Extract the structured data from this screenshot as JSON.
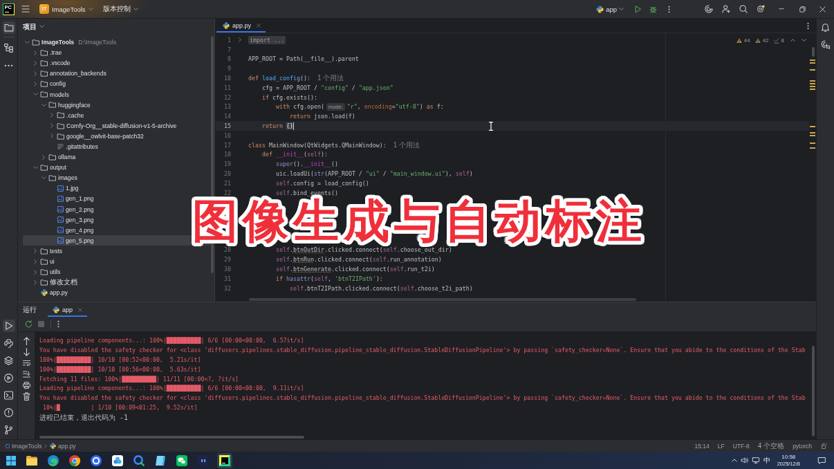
{
  "title_bar": {
    "logo": "PC",
    "project_badge": "IT",
    "project": "ImageTools",
    "vcs": "版本控制",
    "run_config": "app",
    "settings_update": true
  },
  "tool_windows": {
    "left_top": [
      {
        "kind": "project",
        "selected": true
      },
      {
        "kind": "structure",
        "selected": false
      },
      {
        "kind": "more",
        "selected": false
      }
    ],
    "left_bottom": [
      {
        "kind": "run",
        "selected": true
      },
      {
        "kind": "python_console",
        "selected": false
      },
      {
        "kind": "packages",
        "selected": false
      },
      {
        "kind": "services",
        "selected": false
      },
      {
        "kind": "terminal",
        "selected": false
      },
      {
        "kind": "problems",
        "selected": false
      },
      {
        "kind": "git",
        "selected": false
      }
    ],
    "right": [
      {
        "kind": "notifications",
        "selected": false
      },
      {
        "kind": "ai_chat",
        "selected": false
      }
    ]
  },
  "project_panel": {
    "title": "项目",
    "tree": [
      {
        "label": "ImageTools",
        "path": "D:\\ImageTools",
        "kind": "folder",
        "expanded": true,
        "selected": false,
        "children": [
          {
            "label": ".trae",
            "kind": "folder",
            "expanded": false,
            "selected": false
          },
          {
            "label": ".vscode",
            "kind": "folder",
            "expanded": false,
            "selected": false
          },
          {
            "label": "annotation_backends",
            "kind": "folder",
            "expanded": false,
            "selected": false
          },
          {
            "label": "config",
            "kind": "folder",
            "expanded": false,
            "selected": false
          },
          {
            "label": "models",
            "kind": "folder",
            "expanded": true,
            "selected": false,
            "children": [
              {
                "label": "huggingface",
                "kind": "folder",
                "expanded": true,
                "selected": false,
                "children": [
                  {
                    "label": ".cache",
                    "kind": "folder",
                    "expanded": false,
                    "selected": false
                  },
                  {
                    "label": "Comfy-Org__stable-diffusion-v1-5-archive",
                    "kind": "folder",
                    "expanded": false,
                    "selected": false
                  },
                  {
                    "label": "google__owlvit-base-patch32",
                    "kind": "folder",
                    "expanded": false,
                    "selected": false
                  },
                  {
                    "label": ".gitattributes",
                    "kind": "text",
                    "selected": false
                  }
                ]
              },
              {
                "label": "ollama",
                "kind": "folder",
                "expanded": false,
                "selected": false
              }
            ]
          },
          {
            "label": "output",
            "kind": "folder",
            "expanded": true,
            "selected": false,
            "children": [
              {
                "label": "images",
                "kind": "folder",
                "expanded": true,
                "selected": false,
                "children": [
                  {
                    "label": "1.jpg",
                    "kind": "image",
                    "selected": false
                  },
                  {
                    "label": "gen_1.png",
                    "kind": "image",
                    "selected": false
                  },
                  {
                    "label": "gen_2.png",
                    "kind": "image",
                    "selected": false
                  },
                  {
                    "label": "gen_3.png",
                    "kind": "image",
                    "selected": false
                  },
                  {
                    "label": "gen_4.png",
                    "kind": "image",
                    "selected": false
                  },
                  {
                    "label": "gen_5.png",
                    "kind": "image",
                    "selected": true
                  }
                ]
              }
            ]
          },
          {
            "label": "tests",
            "kind": "folder",
            "expanded": false,
            "selected": false
          },
          {
            "label": "ui",
            "kind": "folder",
            "expanded": false,
            "selected": false
          },
          {
            "label": "utils",
            "kind": "folder",
            "expanded": false,
            "selected": false
          },
          {
            "label": "修改文档",
            "kind": "folder",
            "expanded": false,
            "selected": false
          },
          {
            "label": "app.py",
            "kind": "python",
            "selected": false
          }
        ]
      }
    ]
  },
  "editor": {
    "tabs": [
      {
        "label": "app.py",
        "selected": true
      }
    ],
    "inspections": {
      "warnings": "44",
      "weak_warnings": "42",
      "typos": "8"
    },
    "lines": [
      {
        "kind": "code",
        "number": "1",
        "current": false,
        "tokens": [
          {
            "t": "import ...",
            "kind": "folded"
          }
        ]
      },
      {
        "kind": "code",
        "number": "7",
        "current": false
      },
      {
        "kind": "code",
        "number": "8",
        "current": false,
        "tokens": [
          {
            "t": "APP_ROOT = Path(__file__).parent",
            "kind": "plain"
          }
        ]
      },
      {
        "kind": "code",
        "number": "9",
        "current": false
      },
      {
        "kind": "code",
        "number": "10",
        "current": false,
        "tokens": [
          {
            "t": "def ",
            "kind": "keyword"
          },
          {
            "t": "load_config",
            "kind": "fn"
          },
          {
            "t": "():",
            "kind": "plain"
          },
          {
            "t": "1 个用法",
            "kind": "usage"
          }
        ]
      },
      {
        "kind": "code",
        "number": "11",
        "current": false,
        "tokens": [
          {
            "t": "    cfg = APP_ROOT / ",
            "kind": "plain"
          },
          {
            "t": "\"config\"",
            "kind": "string"
          },
          {
            "t": " / ",
            "kind": "plain"
          },
          {
            "t": "\"app.json\"",
            "kind": "string"
          }
        ]
      },
      {
        "kind": "code",
        "number": "12",
        "current": false,
        "tokens": [
          {
            "t": "    if ",
            "kind": "keyword"
          },
          {
            "t": "cfg.exists():",
            "kind": "plain"
          }
        ]
      },
      {
        "kind": "code",
        "number": "13",
        "current": false,
        "tokens": [
          {
            "t": "        with ",
            "kind": "keyword"
          },
          {
            "t": "cfg.open(",
            "kind": "plain"
          },
          {
            "t": "mode:",
            "kind": "hint"
          },
          {
            "t": "\"r\"",
            "kind": "string"
          },
          {
            "t": ", ",
            "kind": "plain"
          },
          {
            "t": "encoding",
            "kind": "param"
          },
          {
            "t": "=",
            "kind": "plain"
          },
          {
            "t": "\"utf-8\"",
            "kind": "string"
          },
          {
            "t": ") ",
            "kind": "plain"
          },
          {
            "t": "as ",
            "kind": "keyword"
          },
          {
            "t": "f:",
            "kind": "plain"
          }
        ]
      },
      {
        "kind": "code",
        "number": "14",
        "current": false,
        "tokens": [
          {
            "t": "            return ",
            "kind": "keyword"
          },
          {
            "t": "json.load(f)",
            "kind": "plain"
          }
        ]
      },
      {
        "kind": "code",
        "number": "15",
        "current": true,
        "tokens": [
          {
            "t": "    return ",
            "kind": "keyword"
          },
          {
            "t": "{}",
            "kind": "brace"
          }
        ]
      },
      {
        "kind": "code",
        "number": "16",
        "current": false
      },
      {
        "kind": "code",
        "number": "17",
        "current": false,
        "tokens": [
          {
            "t": "class ",
            "kind": "keyword"
          },
          {
            "t": "MainWindow(QtWidgets.QMainWindow):",
            "kind": "plain"
          },
          {
            "t": "1 个用法",
            "kind": "usage"
          }
        ]
      },
      {
        "kind": "code",
        "number": "18",
        "current": false,
        "tokens": [
          {
            "t": "    def ",
            "kind": "keyword"
          },
          {
            "t": "__init__",
            "kind": "dunder"
          },
          {
            "t": "(",
            "kind": "plain"
          },
          {
            "t": "self",
            "kind": "self"
          },
          {
            "t": "):",
            "kind": "plain"
          }
        ]
      },
      {
        "kind": "code",
        "number": "19",
        "current": false,
        "tokens": [
          {
            "t": "        super",
            "kind": "builtin"
          },
          {
            "t": "().",
            "kind": "plain"
          },
          {
            "t": "__init__",
            "kind": "dunder"
          },
          {
            "t": "()",
            "kind": "plain"
          }
        ]
      },
      {
        "kind": "code",
        "number": "20",
        "current": false,
        "tokens": [
          {
            "t": "        uic.loadUi(",
            "kind": "plain"
          },
          {
            "t": "str",
            "kind": "builtin"
          },
          {
            "t": "(APP_ROOT / ",
            "kind": "plain"
          },
          {
            "t": "\"ui\"",
            "kind": "string"
          },
          {
            "t": " / ",
            "kind": "plain"
          },
          {
            "t": "\"main_window.ui\"",
            "kind": "string"
          },
          {
            "t": "), ",
            "kind": "plain"
          },
          {
            "t": "self",
            "kind": "self"
          },
          {
            "t": ")",
            "kind": "plain"
          }
        ]
      },
      {
        "kind": "code",
        "number": "21",
        "current": false,
        "tokens": [
          {
            "t": "        self",
            "kind": "self"
          },
          {
            "t": ".config = load_config()",
            "kind": "plain"
          }
        ]
      },
      {
        "kind": "code",
        "number": "22",
        "current": false,
        "tokens": [
          {
            "t": "        self",
            "kind": "self"
          },
          {
            "t": ".bind_events()",
            "kind": "plain"
          }
        ]
      },
      {
        "kind": "covered"
      },
      {
        "kind": "covered"
      },
      {
        "kind": "covered"
      },
      {
        "kind": "covered"
      },
      {
        "kind": "covered"
      },
      {
        "kind": "code",
        "number": "28",
        "current": false,
        "tokens": [
          {
            "t": "        self",
            "kind": "self"
          },
          {
            "t": ".",
            "kind": "plain"
          },
          {
            "t": "btnOutDir",
            "kind": "warn"
          },
          {
            "t": ".clicked.connect(",
            "kind": "plain"
          },
          {
            "t": "self",
            "kind": "self"
          },
          {
            "t": ".choose_out_dir)",
            "kind": "plain"
          }
        ]
      },
      {
        "kind": "code",
        "number": "29",
        "current": false,
        "tokens": [
          {
            "t": "        self",
            "kind": "self"
          },
          {
            "t": ".",
            "kind": "plain"
          },
          {
            "t": "btnRun",
            "kind": "warn"
          },
          {
            "t": ".clicked.connect(",
            "kind": "plain"
          },
          {
            "t": "self",
            "kind": "self"
          },
          {
            "t": ".run_annotation)",
            "kind": "plain"
          }
        ]
      },
      {
        "kind": "code",
        "number": "30",
        "current": false,
        "tokens": [
          {
            "t": "        self",
            "kind": "self"
          },
          {
            "t": ".",
            "kind": "plain"
          },
          {
            "t": "btnGenerate",
            "kind": "warn"
          },
          {
            "t": ".clicked.connect(",
            "kind": "plain"
          },
          {
            "t": "self",
            "kind": "self"
          },
          {
            "t": ".run_t2i)",
            "kind": "plain"
          }
        ]
      },
      {
        "kind": "code",
        "number": "31",
        "current": false,
        "tokens": [
          {
            "t": "        if ",
            "kind": "keyword"
          },
          {
            "t": "hasattr",
            "kind": "builtin"
          },
          {
            "t": "(",
            "kind": "plain"
          },
          {
            "t": "self",
            "kind": "self"
          },
          {
            "t": ", ",
            "kind": "plain"
          },
          {
            "t": "'btnT2IPath'",
            "kind": "string"
          },
          {
            "t": "):",
            "kind": "plain"
          }
        ]
      },
      {
        "kind": "code",
        "number": "32",
        "current": false,
        "tokens": [
          {
            "t": "            self",
            "kind": "self"
          },
          {
            "t": ".btnT2IPath.clicked.connect(",
            "kind": "plain"
          },
          {
            "t": "self",
            "kind": "self"
          },
          {
            "t": ".choose_t2i_path)",
            "kind": "plain"
          }
        ]
      }
    ]
  },
  "caption": "图像生成与自动标注",
  "run_panel": {
    "title": "运行",
    "tabs": [
      {
        "label": "app",
        "selected": true
      }
    ],
    "toolbar": [
      {
        "kind": "rerun",
        "disabled": false
      },
      {
        "kind": "stop",
        "disabled": true
      }
    ],
    "console": [
      {
        "kind": "stderr",
        "text": "Loading pipeline components...: 100%|██████████| 6/6 [00:00<00:00,  6.57it/s]"
      },
      {
        "kind": "stderr",
        "text": "You have disabled the safety checker for <class 'diffusers.pipelines.stable_diffusion.pipeline_stable_diffusion.StableDiffusionPipeline'> by passing `safety_checker=None`. Ensure that you abide to the conditions of the Stab"
      },
      {
        "kind": "stderr",
        "text": "100%|██████████| 10/10 [00:52<00:00,  5.21s/it]"
      },
      {
        "kind": "stderr",
        "text": "100%|██████████| 10/10 [00:56<00:00,  5.63s/it]"
      },
      {
        "kind": "stderr",
        "text": "Fetching 11 files: 100%|██████████| 11/11 [00:00<?, ?it/s]"
      },
      {
        "kind": "stderr",
        "text": "Loading pipeline components...: 100%|██████████| 6/6 [00:00<00:00,  9.11it/s]"
      },
      {
        "kind": "stderr",
        "text": "You have disabled the safety checker for <class 'diffusers.pipelines.stable_diffusion.pipeline_stable_diffusion.StableDiffusionPipeline'> by passing `safety_checker=None`. Ensure that you abide to the conditions of the Stab"
      },
      {
        "kind": "stderr",
        "text": " 10%|█         | 1/10 [00:09<01:25,  9.52s/it]"
      },
      {
        "kind": "info",
        "text": "进程已结束，退出代码为 -1"
      }
    ]
  },
  "status_bar": {
    "breadcrumbs": [
      {
        "label": "ImageTools",
        "kind": "module"
      },
      {
        "label": "app.py",
        "kind": "python"
      }
    ],
    "caret": "15:14",
    "line_separator": "LF",
    "encoding": "UTF-8",
    "indent": "4 个空格",
    "interpreter": "pytorch"
  },
  "taskbar": {
    "apps": [
      {
        "kind": "explorer",
        "selected": false
      },
      {
        "kind": "edge",
        "selected": false
      },
      {
        "kind": "chrome",
        "selected": false
      },
      {
        "kind": "disc_app",
        "selected": false
      },
      {
        "kind": "dots_app",
        "selected": false
      },
      {
        "kind": "lens_app",
        "selected": false
      },
      {
        "kind": "book_app",
        "selected": false
      },
      {
        "kind": "wechat",
        "selected": false
      },
      {
        "kind": "dark_app",
        "selected": false
      },
      {
        "kind": "pycharm",
        "selected": true
      }
    ],
    "tray": {
      "ime": "中",
      "time": "10:58",
      "date": "2025/12/8"
    }
  }
}
